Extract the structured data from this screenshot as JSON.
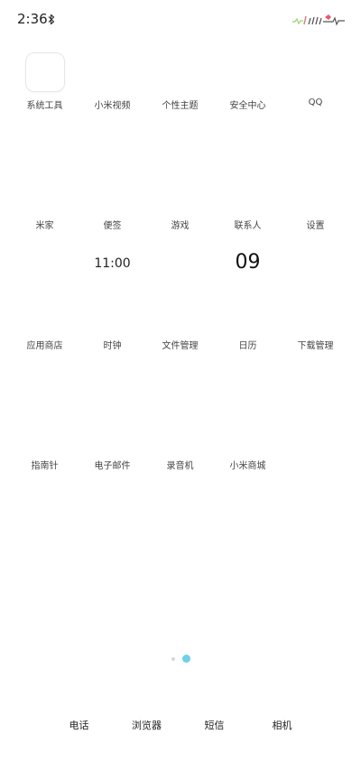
{
  "status_bar": {
    "time": "2:36",
    "icons": [
      "bluetooth-icon",
      "signal-icon",
      "battery-icon"
    ]
  },
  "apps": [
    {
      "label": "系统工具",
      "icon": "folder-icon"
    },
    {
      "label": "小米视频",
      "icon": "video-icon"
    },
    {
      "label": "个性主题",
      "icon": "theme-icon"
    },
    {
      "label": "安全中心",
      "icon": "shield-icon"
    },
    {
      "label": "QQ",
      "icon": "qq-icon"
    },
    {
      "label": "米家",
      "icon": "home-icon"
    },
    {
      "label": "便签",
      "icon": "notes-icon"
    },
    {
      "label": "游戏",
      "icon": "game-icon"
    },
    {
      "label": "联系人",
      "icon": "contacts-icon"
    },
    {
      "label": "设置",
      "icon": "settings-icon"
    },
    {
      "label": "应用商店",
      "icon": "store-icon"
    },
    {
      "label": "时钟",
      "icon": "clock-icon",
      "text": "11:00"
    },
    {
      "label": "文件管理",
      "icon": "files-icon"
    },
    {
      "label": "日历",
      "icon": "calendar-icon",
      "text": "09"
    },
    {
      "label": "下载管理",
      "icon": "download-icon"
    },
    {
      "label": "指南针",
      "icon": "compass-icon"
    },
    {
      "label": "电子邮件",
      "icon": "email-icon"
    },
    {
      "label": "录音机",
      "icon": "recorder-icon"
    },
    {
      "label": "小米商城",
      "icon": "mall-icon"
    }
  ],
  "page_indicator": {
    "pages": 2,
    "current": 2
  },
  "dock": [
    {
      "label": "电话",
      "icon": "phone-icon"
    },
    {
      "label": "浏览器",
      "icon": "browser-icon"
    },
    {
      "label": "短信",
      "icon": "sms-icon"
    },
    {
      "label": "相机",
      "icon": "camera-icon"
    }
  ],
  "colors": {
    "accent": "#6fd0e6",
    "dot_inactive": "#d7d7d7"
  }
}
